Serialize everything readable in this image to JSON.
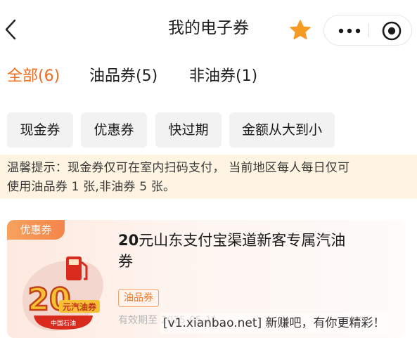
{
  "header": {
    "title": "我的电子券",
    "back_icon": "chevron-left-icon",
    "favorite_icon": "star-icon",
    "more_icon": "more-dots-icon",
    "close_icon": "target-close-icon",
    "colors": {
      "star": "#f59a23"
    }
  },
  "tabs": [
    {
      "label": "全部(6)",
      "active": true
    },
    {
      "label": "油品券(5)",
      "active": false
    },
    {
      "label": "非油券(1)",
      "active": false
    }
  ],
  "filters": [
    "现金券",
    "优惠券",
    "快过期",
    "金额从大到小"
  ],
  "notice": {
    "line1": "温馨提示：现金券仅可在室内扫码支付， 当前地区每人每日仅可",
    "line2": "使用油品券 1 张,非油券 5 张。"
  },
  "coupon": {
    "type_label": "优惠券",
    "amount": "20",
    "title_rest": "元山东支付宝渠道新客专属汽油券",
    "category_tag": "油品券",
    "valid_text": "有效期至 2025-05-11",
    "image": {
      "amount": "20",
      "badge_text": "元汽油券",
      "brand_text": "中国石油",
      "icon": "fuel-pump-icon"
    }
  },
  "watermark": "[v1.xianbao.net] 新赚吧，有你更精彩！",
  "colors": {
    "accent": "#f06b1d",
    "notice_bg": "#fff4e2",
    "filter_bg": "#f2f2f2",
    "tag_orange": "#f3864a"
  }
}
